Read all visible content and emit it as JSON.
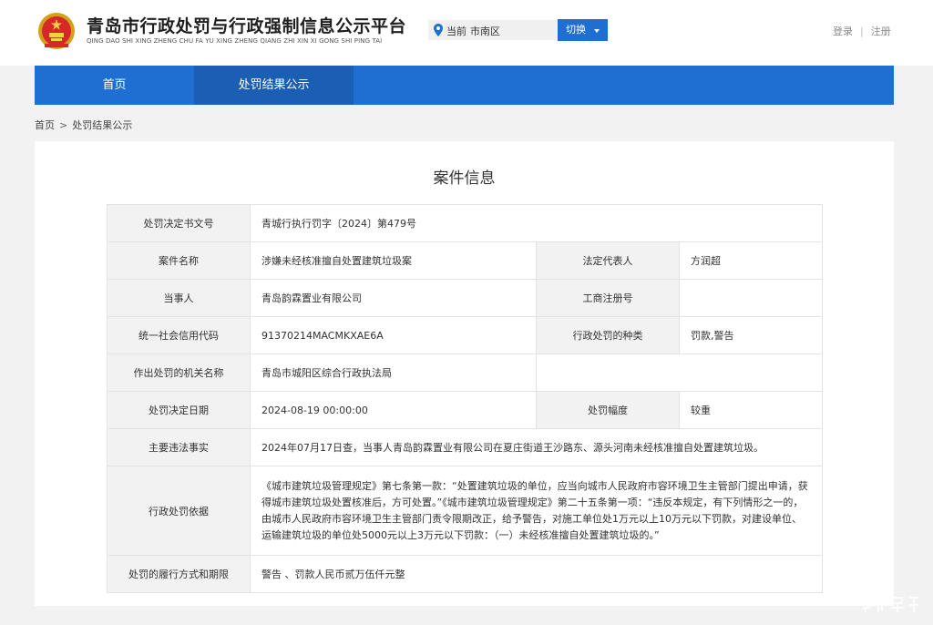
{
  "header": {
    "title": "青岛市行政处罚与行政强制信息公示平台",
    "pinyin": "QING DAO SHI XING ZHENG CHU FA YU XING ZHENG QIANG ZHI XIN XI GONG SHI PING TAI",
    "location_prefix": "当前",
    "location_city": "市南区",
    "switch_label": "切换",
    "login": "登录",
    "auth_separator": "|",
    "register": "注册"
  },
  "nav": {
    "items": [
      {
        "label": "首页"
      },
      {
        "label": "处罚结果公示"
      }
    ]
  },
  "breadcrumb": {
    "home": "首页",
    "separator": ">",
    "current": "处罚结果公示"
  },
  "case": {
    "title": "案件信息",
    "rows": {
      "doc_no": {
        "label": "处罚决定书文号",
        "value": "青城行执行罚字〔2024〕第479号"
      },
      "case_name": {
        "label": "案件名称",
        "value": "涉嫌未经核准擅自处置建筑垃圾案"
      },
      "legal_rep": {
        "label": "法定代表人",
        "value": "方润超"
      },
      "party": {
        "label": "当事人",
        "value": "青岛韵霖置业有限公司"
      },
      "biz_reg_no": {
        "label": "工商注册号",
        "value": ""
      },
      "credit_code": {
        "label": "统一社会信用代码",
        "value": "91370214MACMKXAE6A"
      },
      "penalty_type": {
        "label": "行政处罚的种类",
        "value": "罚款,警告"
      },
      "authority": {
        "label": "作出处罚的机关名称",
        "value": "青岛市城阳区综合行政执法局"
      },
      "decision_date": {
        "label": "处罚决定日期",
        "value": "2024-08-19 00:00:00"
      },
      "penalty_range": {
        "label": "处罚幅度",
        "value": "较重"
      },
      "violation_facts": {
        "label": "主要违法事实",
        "value": "2024年07月17日查，当事人青岛韵霖置业有限公司在夏庄街道王沙路东、源头河南未经核准擅自处置建筑垃圾。"
      },
      "legal_basis": {
        "label": "行政处罚依据",
        "value": "《城市建筑垃圾管理规定》第七条第一款：“处置建筑垃圾的单位，应当向城市人民政府市容环境卫生主管部门提出申请，获得城市建筑垃圾处置核准后，方可处置。”《城市建筑垃圾管理规定》第二十五条第一项：“违反本规定，有下列情形之一的，由城市人民政府市容环境卫生主管部门责令限期改正，给予警告，对施工单位处1万元以上10万元以下罚款，对建设单位、运输建筑垃圾的单位处5000元以上3万元以下罚款：（一）未经核准擅自处置建筑垃圾的。”"
      },
      "execution": {
        "label": "处罚的履行方式和期限",
        "value": "警告 、罚款人民币贰万伍仟元整"
      }
    }
  },
  "colors": {
    "primary": "#1e6fd1",
    "nav_active": "#1a5fb4",
    "label_bg": "#f2f2f2",
    "page_bg": "#f2f2f2"
  },
  "icons": {
    "emblem": "national-emblem-icon",
    "location": "location-pin-icon",
    "dropdown": "caret-down-icon"
  }
}
